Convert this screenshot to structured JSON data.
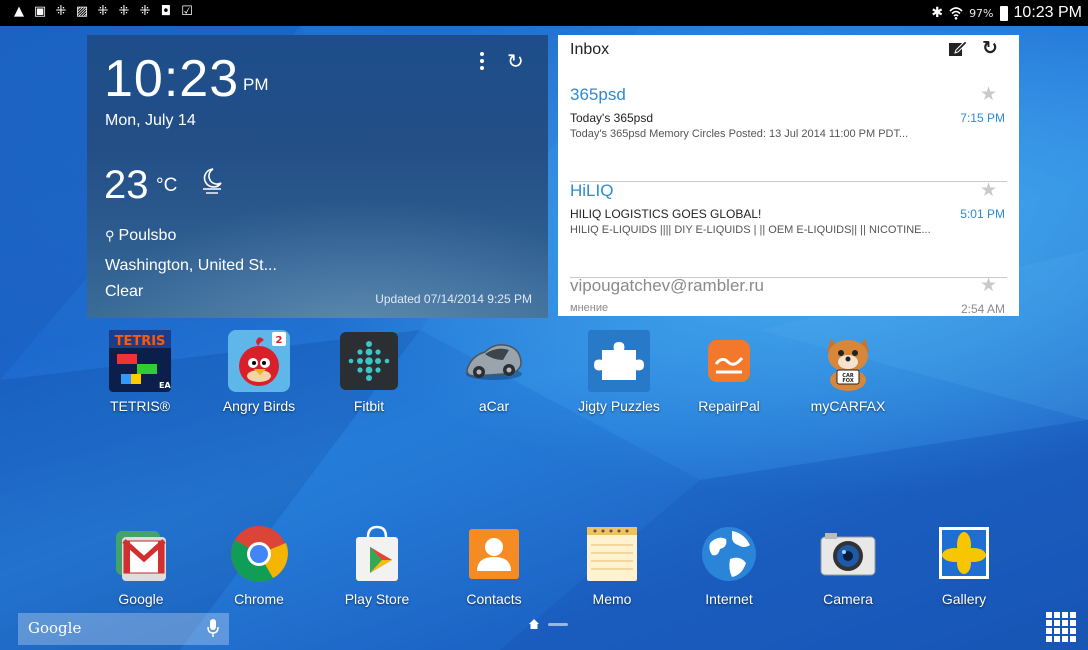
{
  "status_bar": {
    "time": "10:23 PM",
    "battery": "97%",
    "left_icons": [
      "warning-icon",
      "image-icon",
      "dots-icon",
      "screenshot-icon",
      "dots-icon",
      "dots-icon",
      "dots-icon",
      "bag-icon",
      "check-icon"
    ]
  },
  "weather": {
    "time": "10:23",
    "ampm": "PM",
    "date": "Mon, July 14",
    "temperature": "23",
    "unit": "°C",
    "city": "Poulsbo",
    "region": "Washington, United St...",
    "condition": "Clear",
    "updated": "Updated 07/14/2014 9:25 PM"
  },
  "inbox": {
    "title": "Inbox",
    "messages": [
      {
        "sender": "365psd",
        "subject": "Today's 365psd",
        "time": "7:15 PM",
        "preview": "Today's 365psd Memory Circles Posted: 13 Jul 2014 11:00 PM PDT..."
      },
      {
        "sender": "HiLIQ",
        "subject": "HILIQ LOGISTICS GOES GLOBAL!",
        "time": "5:01 PM",
        "preview": "HILIQ E-LIQUIDS |||| DIY E-LIQUIDS | || OEM E-LIQUIDS|| || NICOTINE..."
      },
      {
        "sender": "vipougatchev@rambler.ru",
        "subject": "мнение",
        "time": "2:54 AM",
        "preview": ""
      }
    ]
  },
  "apps_row1": [
    {
      "label": "TETRIS®",
      "icon": "tetris-icon"
    },
    {
      "label": "Angry Birds",
      "icon": "angry-birds-icon"
    },
    {
      "label": "Fitbit",
      "icon": "fitbit-icon"
    },
    {
      "label": "aCar",
      "icon": "acar-icon"
    },
    {
      "label": "Jigty Puzzles",
      "icon": "puzzle-icon"
    },
    {
      "label": "RepairPal",
      "icon": "repairpal-icon"
    },
    {
      "label": "myCARFAX",
      "icon": "carfax-icon"
    }
  ],
  "dock": [
    {
      "label": "Google",
      "icon": "gmail-folder-icon"
    },
    {
      "label": "Chrome",
      "icon": "chrome-icon"
    },
    {
      "label": "Play Store",
      "icon": "play-store-icon"
    },
    {
      "label": "Contacts",
      "icon": "contacts-icon"
    },
    {
      "label": "Memo",
      "icon": "memo-icon"
    },
    {
      "label": "Internet",
      "icon": "globe-icon"
    },
    {
      "label": "Camera",
      "icon": "camera-icon"
    },
    {
      "label": "Gallery",
      "icon": "gallery-icon"
    }
  ],
  "search_bar": {
    "logo": "Google"
  },
  "colors": {
    "link_blue": "#2b8bd6",
    "wallpaper": "#1c67cf",
    "status_bar": "#000000"
  }
}
